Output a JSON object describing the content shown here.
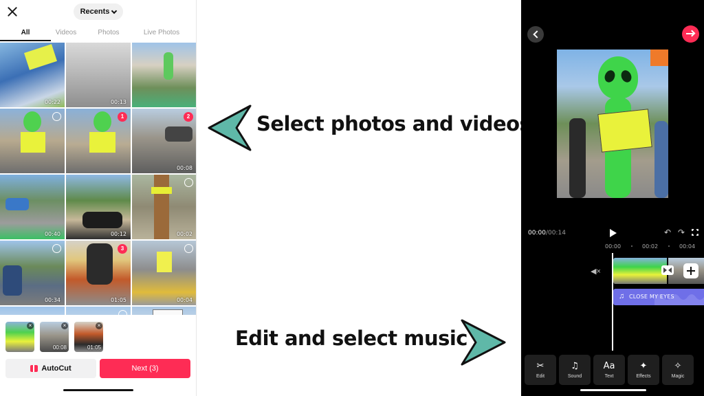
{
  "left_screen": {
    "album_selector": "Recents",
    "tabs": [
      "All",
      "Videos",
      "Photos",
      "Live Photos"
    ],
    "grid": [
      {
        "duration": "00:22",
        "selected_index": ""
      },
      {
        "duration": "00:13",
        "selected_index": ""
      },
      {
        "duration": "",
        "selected_index": ""
      },
      {
        "duration": "",
        "selected_index": ""
      },
      {
        "duration": "",
        "selected_index": "1"
      },
      {
        "duration": "00:08",
        "selected_index": "2"
      },
      {
        "duration": "00:40",
        "selected_index": ""
      },
      {
        "duration": "00:12",
        "selected_index": ""
      },
      {
        "duration": "00:02",
        "selected_index": ""
      },
      {
        "duration": "00:34",
        "selected_index": ""
      },
      {
        "duration": "01:05",
        "selected_index": "3"
      },
      {
        "duration": "00:04",
        "selected_index": ""
      }
    ],
    "selected_strip": [
      {
        "duration": ""
      },
      {
        "duration": "00:08"
      },
      {
        "duration": "01:05"
      }
    ],
    "autocut_label": "AutoCut",
    "next_label": "Next (3)"
  },
  "captions": {
    "select": "Select photos and videos",
    "edit": "Edit and select music"
  },
  "right_screen": {
    "timecode_current": "00:00",
    "timecode_total": "00:14",
    "ruler": [
      "00:00",
      "00:02",
      "00:04"
    ],
    "music_track": "CLOSE MY EYES",
    "tools": [
      {
        "label": "Edit",
        "icon": "scissors-icon",
        "glyph": "✂"
      },
      {
        "label": "Sound",
        "icon": "music-note-icon",
        "glyph": "♫"
      },
      {
        "label": "Text",
        "icon": "text-icon",
        "glyph": "Aa"
      },
      {
        "label": "Effects",
        "icon": "sparkle-icon",
        "glyph": "✦"
      },
      {
        "label": "Magic",
        "icon": "magic-icon",
        "glyph": "✧"
      }
    ]
  },
  "colors": {
    "accent": "#fe2c55",
    "callout_teal": "#5fb8a8",
    "music_track": "#6f6fe8",
    "editor_bg": "#000000"
  }
}
